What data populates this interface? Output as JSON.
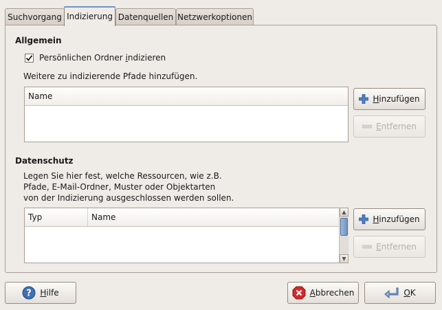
{
  "tabs": [
    {
      "label": "Suchvorgang"
    },
    {
      "label": "Indizierung"
    },
    {
      "label": "Datenquellen"
    },
    {
      "label": "Netzwerkoptionen"
    }
  ],
  "general": {
    "title": "Allgemein",
    "checkbox_label_pre": "Persönlichen Ordner ",
    "checkbox_label_underlined": "i",
    "checkbox_label_post": "ndizieren",
    "checkbox_checked": true,
    "paths_hint": "Weitere zu indizierende Pfade hinzufügen.",
    "list_header_name": "Name",
    "add_pre": "",
    "add_u": "H",
    "add_post": "inzufügen",
    "remove_pre": "",
    "remove_u": "E",
    "remove_post": "ntfernen"
  },
  "privacy": {
    "title": "Datenschutz",
    "desc_line1": "Legen Sie hier fest, welche Ressourcen, wie z.B.",
    "desc_line2": "Pfade, E-Mail-Ordner, Muster oder Objektarten",
    "desc_line3": "von der Indizierung ausgeschlossen werden sollen.",
    "col_type": "Typ",
    "col_name": "Name",
    "add_u": "H",
    "add_post": "inzufügen",
    "remove_u": "E",
    "remove_post": "ntfernen"
  },
  "footer": {
    "help_u": "H",
    "help_post": "ilfe",
    "cancel_u": "A",
    "cancel_post": "bbrechen",
    "ok_u": "O",
    "ok_post": "K"
  },
  "colors": {
    "window_bg": "#efebe7",
    "accent": "#6d93c4",
    "cancel_red": "#d12a2a",
    "help_blue": "#3f6fb5"
  }
}
